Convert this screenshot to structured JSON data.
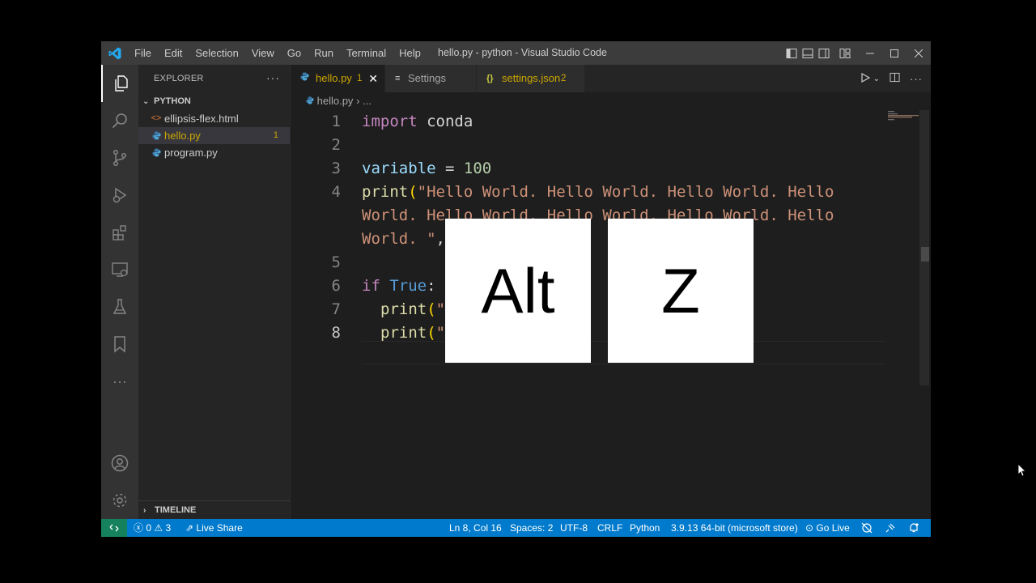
{
  "titlebar": {
    "menu": [
      "File",
      "Edit",
      "Selection",
      "View",
      "Go",
      "Run",
      "Terminal",
      "Help"
    ],
    "title": "hello.py - python - Visual Studio Code",
    "window_controls": [
      "minimize",
      "maximize",
      "close"
    ]
  },
  "activity_bar": {
    "items": [
      "explorer-icon",
      "search-icon",
      "source-control-icon",
      "run-debug-icon",
      "extensions-icon",
      "remote-explorer-icon",
      "testing-icon",
      "bookmarks-icon",
      "more-icon"
    ],
    "bottom": [
      "accounts-icon",
      "manage-gear-icon"
    ],
    "more_label": "···"
  },
  "sidebar": {
    "header": "EXPLORER",
    "more": "···",
    "folder": "PYTHON",
    "files": [
      {
        "icon": "<>",
        "name": "ellipsis-flex.html",
        "badge": ""
      },
      {
        "icon": "py",
        "name": "hello.py",
        "badge": "1",
        "selected": true
      },
      {
        "icon": "py",
        "name": "program.py",
        "badge": ""
      }
    ],
    "timeline": "TIMELINE"
  },
  "tabs": [
    {
      "label": "hello.py",
      "badge": "1",
      "active": true
    },
    {
      "label": "Settings",
      "badge": ""
    },
    {
      "label": "settings.json",
      "badge": "2"
    }
  ],
  "tab_icons": {
    "settings": "≡",
    "json": "{}"
  },
  "breadcrumb": {
    "file": "hello.py",
    "rest": "..."
  },
  "code": {
    "line_numbers": [
      "1",
      "2",
      "3",
      "4",
      "",
      "",
      "5",
      "6",
      "7",
      "8"
    ],
    "current_line": "8"
  },
  "status_bar": {
    "remote": "><",
    "errors": "0",
    "warnings": "3",
    "live_share": "Live Share",
    "position": "Ln 8, Col 16",
    "spaces": "Spaces: 2",
    "encoding": "UTF-8",
    "eol": "CRLF",
    "language": "Python",
    "interpreter": "3.9.13 64-bit (microsoft store)",
    "go_live": "Go Live"
  },
  "keys": {
    "key1": "Alt",
    "key2": "Z"
  },
  "colors": {
    "accent": "#007acc",
    "remote": "#16825d",
    "keyword": "#c586c0",
    "string": "#ce9178",
    "function": "#dcdcaa",
    "variable": "#9cdcfe",
    "number": "#b5cea8",
    "constant": "#569cd6",
    "badge": "#cca700"
  }
}
